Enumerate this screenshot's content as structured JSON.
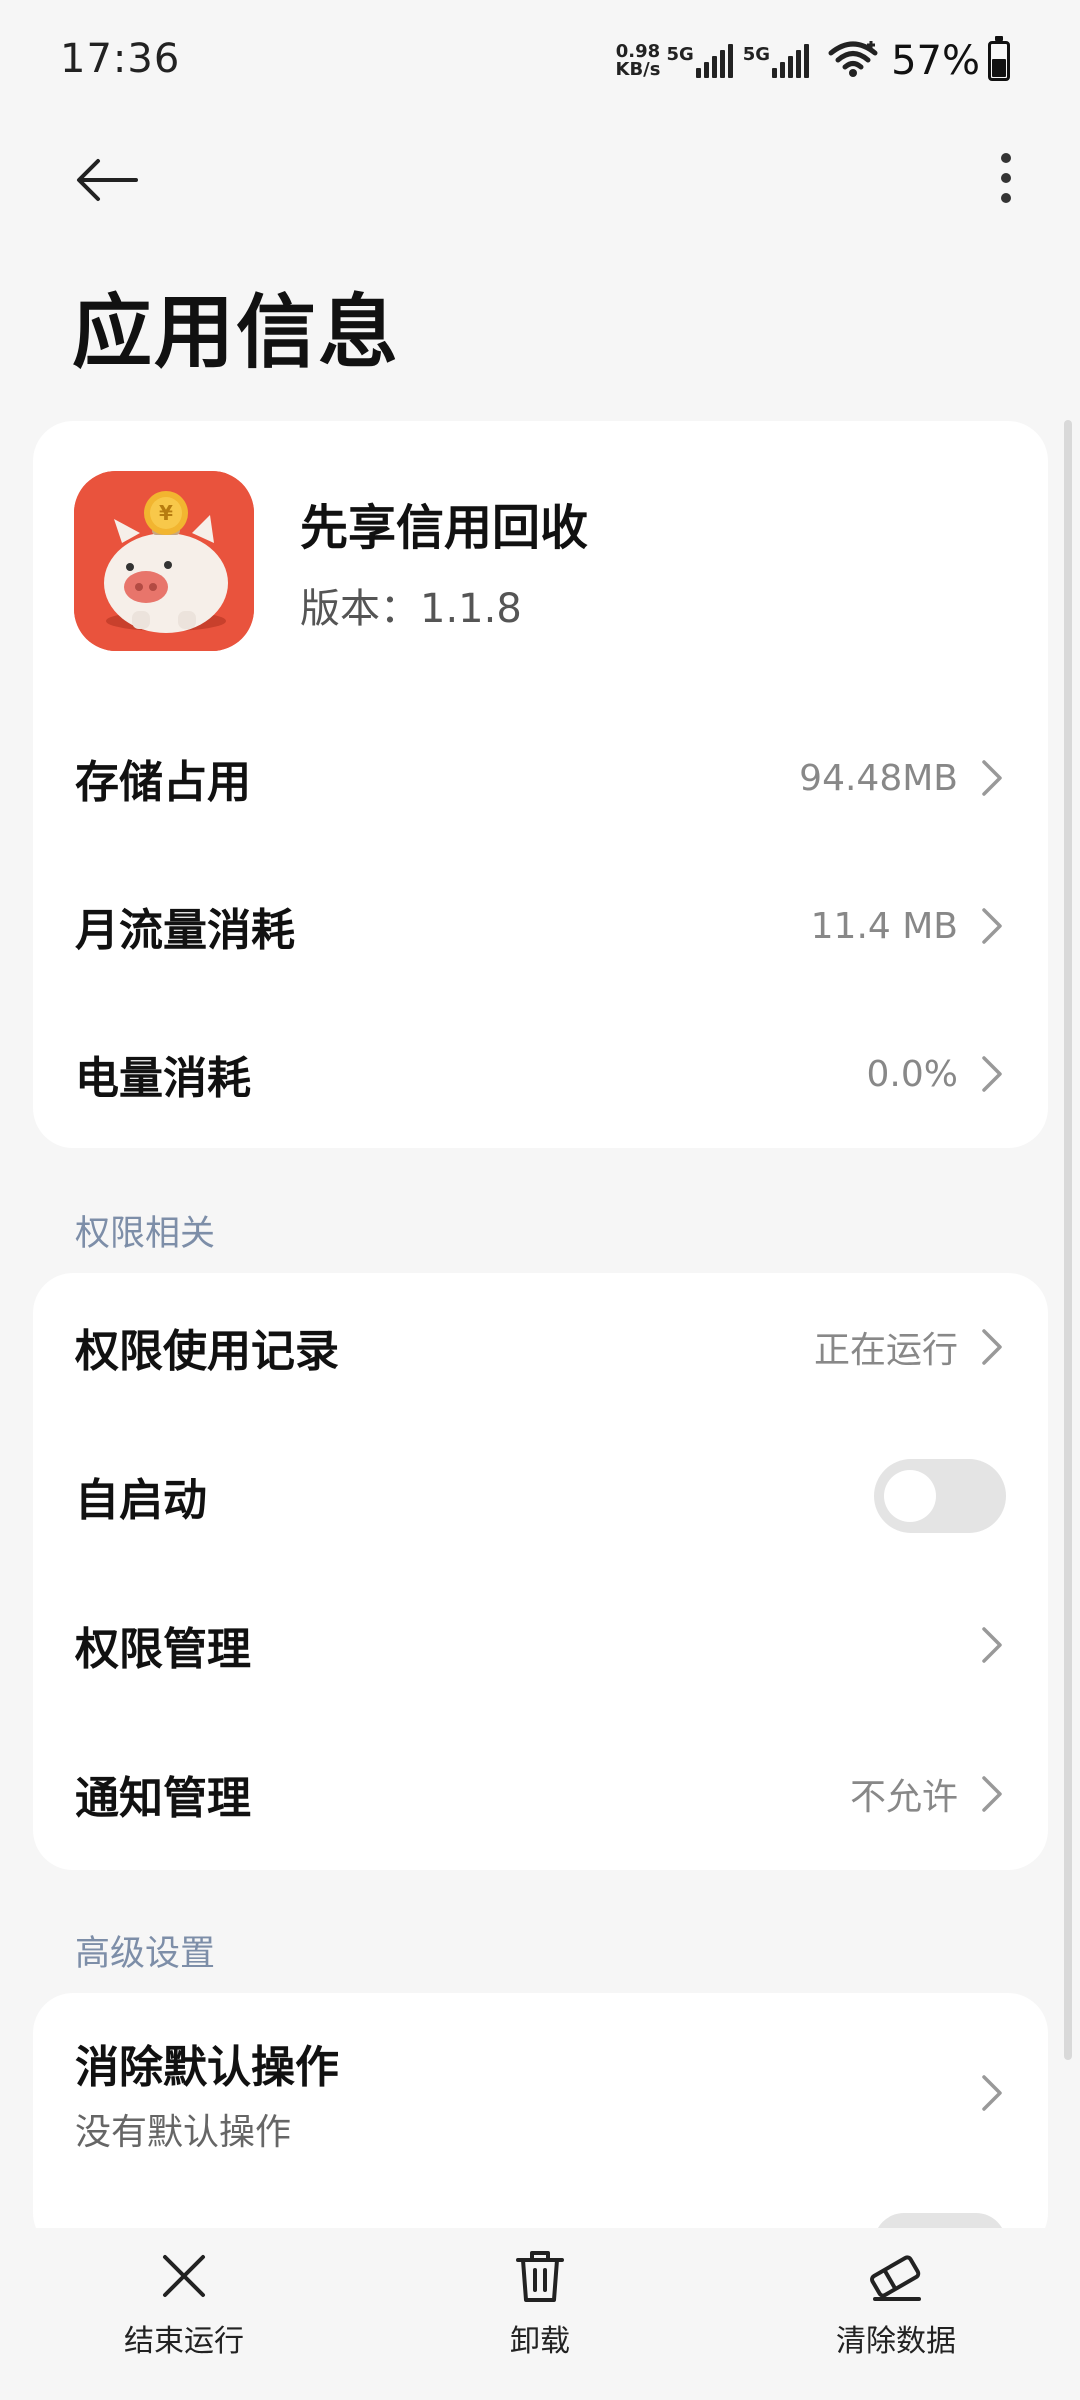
{
  "status_bar": {
    "time": "17:36",
    "speed_value": "0.98",
    "speed_unit": "KB/s",
    "net1": "5G",
    "net2": "5G",
    "battery": "57%",
    "battery_level": 0.57
  },
  "header": {
    "title": "应用信息",
    "back_icon": "arrow-left-icon",
    "more_icon": "more-vertical-icon"
  },
  "app": {
    "name": "先享信用回收",
    "version": "版本：1.1.8",
    "icon": "piggy-bank-app-icon"
  },
  "usage": [
    {
      "label": "存储占用",
      "value": "94.48MB"
    },
    {
      "label": "月流量消耗",
      "value": "11.4 MB"
    },
    {
      "label": "电量消耗",
      "value": "0.0%"
    }
  ],
  "permissions": {
    "section_title": "权限相关",
    "items": [
      {
        "label": "权限使用记录",
        "value": "正在运行"
      },
      {
        "label": "自启动",
        "toggle": false
      },
      {
        "label": "权限管理",
        "value": ""
      },
      {
        "label": "通知管理",
        "value": "不允许"
      }
    ]
  },
  "advanced": {
    "section_title": "高级设置",
    "items": [
      {
        "label": "消除默认操作",
        "desc": "没有默认操作"
      }
    ]
  },
  "bottom_bar": {
    "stop": {
      "label": "结束运行",
      "icon": "close-icon"
    },
    "uninstall": {
      "label": "卸载",
      "icon": "trash-icon"
    },
    "clear": {
      "label": "清除数据",
      "icon": "eraser-icon"
    }
  },
  "colors": {
    "accent_section": "#7d8ea8",
    "app_icon_bg": "#e9533d"
  }
}
